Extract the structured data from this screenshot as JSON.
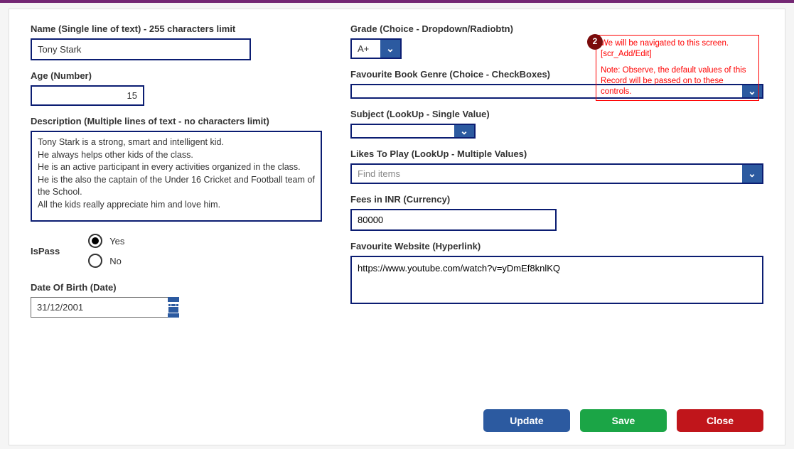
{
  "left": {
    "name_label": "Name (Single line of text) - 255 characters limit",
    "name_value": "Tony Stark",
    "age_label": "Age (Number)",
    "age_value": "15",
    "desc_label": "Description (Multiple lines of text - no characters limit)",
    "desc_value": "Tony Stark is a strong, smart and intelligent kid.\nHe always helps other kids of the class.\nHe is an active participant in every activities organized in the class.\nHe is the also the captain of the Under 16 Cricket and Football team of the School.\nAll the kids really appreciate him and love him.",
    "ispass_label": "IsPass",
    "ispass_options": {
      "yes": "Yes",
      "no": "No"
    },
    "ispass_selected": "yes",
    "dob_label": "Date Of Birth (Date)",
    "dob_value": "31/12/2001"
  },
  "right": {
    "grade_label": "Grade (Choice - Dropdown/Radiobtn)",
    "grade_value": "A+",
    "genre_label": "Favourite Book Genre (Choice - CheckBoxes)",
    "genre_value": "",
    "subject_label": "Subject (LookUp - Single Value)",
    "subject_value": "",
    "likes_label": "Likes To Play (LookUp - Multiple Values)",
    "likes_placeholder": "Find items",
    "fees_label": "Fees in INR (Currency)",
    "fees_value": "80000",
    "website_label": "Favourite Website (Hyperlink)",
    "website_value": "https://www.youtube.com/watch?v=yDmEf8knlKQ"
  },
  "annotation": {
    "badge": "2",
    "line1": "We will be navigated to this screen.",
    "line2": "[scr_Add/Edit]",
    "note": "Note: Observe, the default values of this Record will be passed on to these controls."
  },
  "buttons": {
    "update": "Update",
    "save": "Save",
    "close": "Close"
  }
}
